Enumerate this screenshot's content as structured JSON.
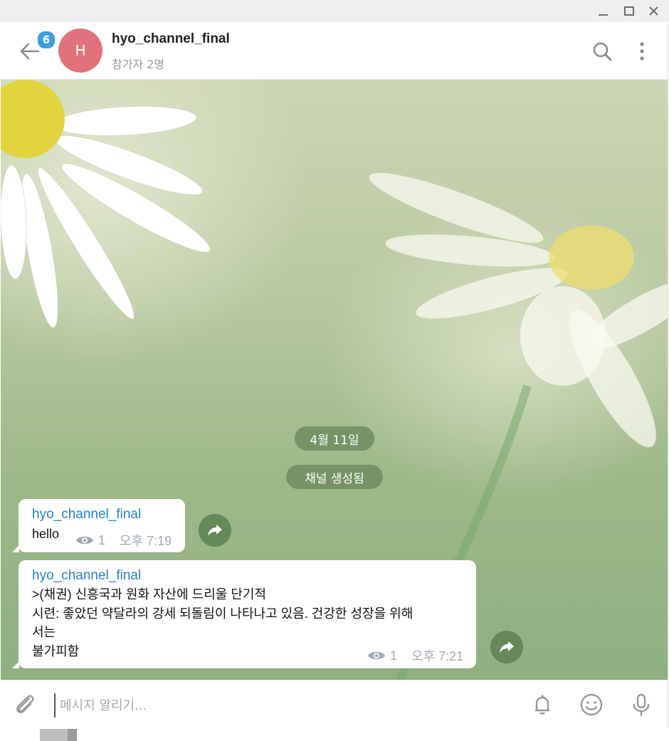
{
  "window_controls": {
    "minimize_icon": "minimize-icon",
    "maximize_icon": "maximize-icon",
    "close_icon": "close-icon"
  },
  "header": {
    "unread_badge": "6",
    "avatar_initial": "H",
    "avatar_color": "#e0727b",
    "chat_name": "hyo_channel_final",
    "participants": "참가자 2명"
  },
  "service_messages": {
    "date": "4월 11일",
    "created": "채널 생성됨"
  },
  "messages": [
    {
      "author": "hyo_channel_final",
      "text": "hello",
      "views": "1",
      "time": "오후 7:19"
    },
    {
      "author": "hyo_channel_final",
      "lines": [
        ">(채권) 신흥국과 원화 자산에 드리울 단기적",
        "시련: 좋았던 약달라의 강세 되돌림이 나타나고 있음. 건강한 성장을 위해",
        "서는",
        "불가피함"
      ],
      "views": "1",
      "time": "오후 7:21"
    }
  ],
  "composer": {
    "placeholder": "메시지 알리기..."
  },
  "colors": {
    "accent": "#2481cc",
    "badge": "#3c9ee0",
    "service_pill": "#6d8c5e"
  }
}
